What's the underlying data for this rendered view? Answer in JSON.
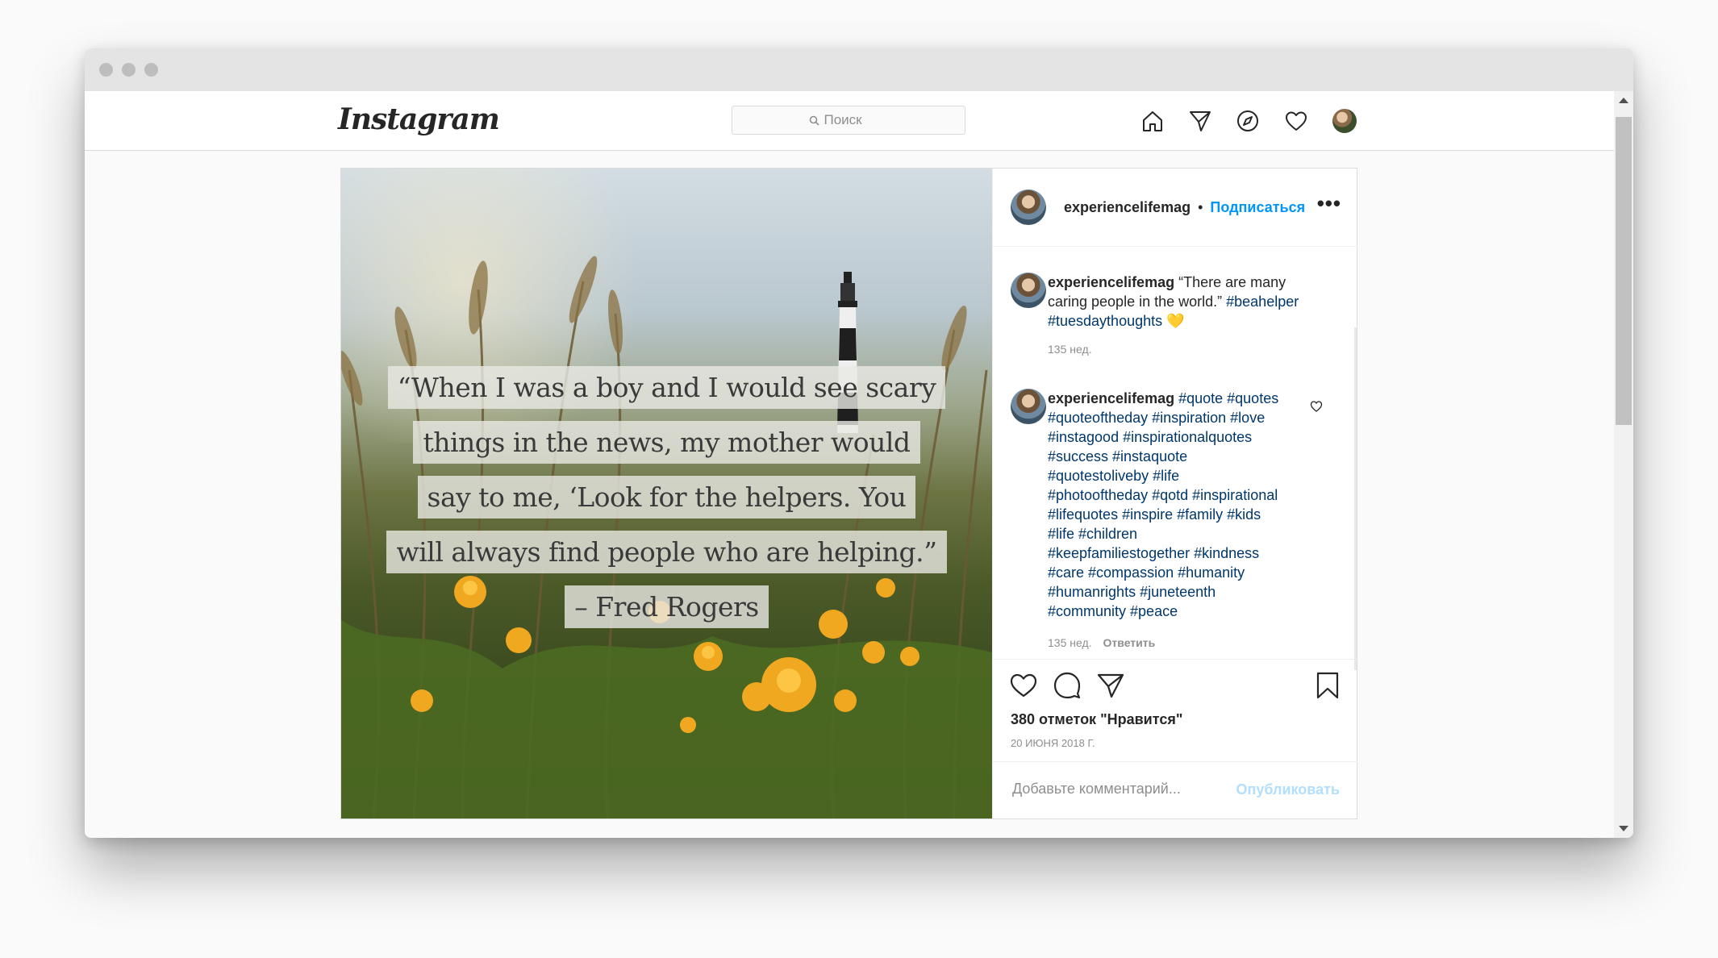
{
  "header": {
    "logo": "Instagram",
    "search_placeholder": "Поиск",
    "nav_icons": [
      "home-icon",
      "direct-icon",
      "explore-icon",
      "activity-icon",
      "profile-avatar"
    ]
  },
  "post": {
    "image_quote_lines": [
      "“When I was a boy and I would see scary",
      "things in the news, my mother would",
      "say to me, ‘Look for the helpers. You",
      "will always find people who are helping.”",
      "– Fred Rogers"
    ],
    "author": "experiencelifemag",
    "separator": "•",
    "follow_label": "Подписаться",
    "more_label": "•••",
    "comments": [
      {
        "username": "experiencelifemag",
        "text_plain": "“There are many caring people in the world.”",
        "hashtags": "#beahelper #tuesdaythoughts",
        "emoji": "💛",
        "time": "135 нед."
      },
      {
        "username": "experiencelifemag",
        "hashtags": "#quote #quotes #quoteoftheday #inspiration #love #instagood #inspirationalquotes #success #instaquote #quotestoliveby #life #photooftheday #qotd #inspirational #lifequotes #inspire #family #kids #life #children #keepfamiliestogether #kindness #care #compassion #humanity #humanrights #juneteenth #community #peace",
        "time": "135 нед.",
        "reply_label": "Ответить"
      }
    ],
    "likes": "380 отметок \"Нравится\"",
    "date": "20 ИЮНЯ 2018 Г.",
    "comment_placeholder": "Добавьте комментарий...",
    "publish_label": "Опубликовать"
  },
  "colors": {
    "link_blue": "#0095f6",
    "hashtag": "#00376b",
    "publish_disabled": "#b2dffc",
    "muted": "#8e8e8e"
  }
}
